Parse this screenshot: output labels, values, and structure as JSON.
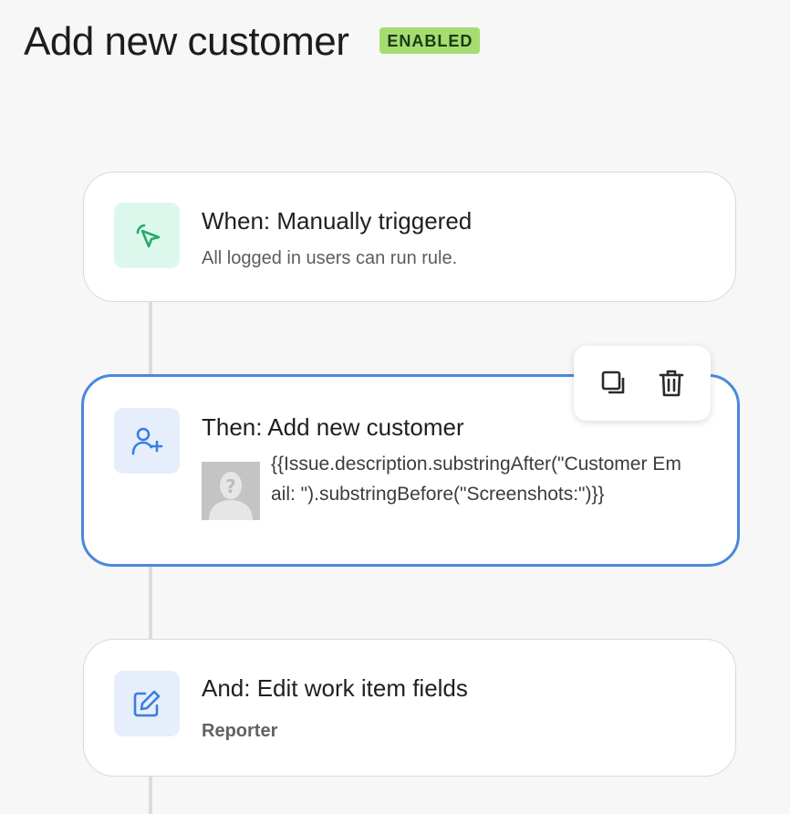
{
  "header": {
    "title": "Add new customer",
    "status": "ENABLED"
  },
  "colors": {
    "accent": "#4a88db",
    "badge": "#a6dd72",
    "trigger_icon": "#2aa86b"
  },
  "steps": [
    {
      "title": "When: Manually triggered",
      "subtitle": "All logged in users can run rule.",
      "icon": "cursor-click-icon"
    },
    {
      "title": "Then: Add new customer",
      "expression": "{{Issue.description.substringAfter(\"Customer Email: \").substringBefore(\"Screenshots:\")}}",
      "icon": "add-user-icon",
      "avatar": "placeholder-avatar-icon"
    },
    {
      "title": "And: Edit work item fields",
      "subtitle": "Reporter",
      "icon": "edit-icon"
    }
  ],
  "toolbar": {
    "items": [
      "duplicate-icon",
      "trash-icon"
    ]
  }
}
